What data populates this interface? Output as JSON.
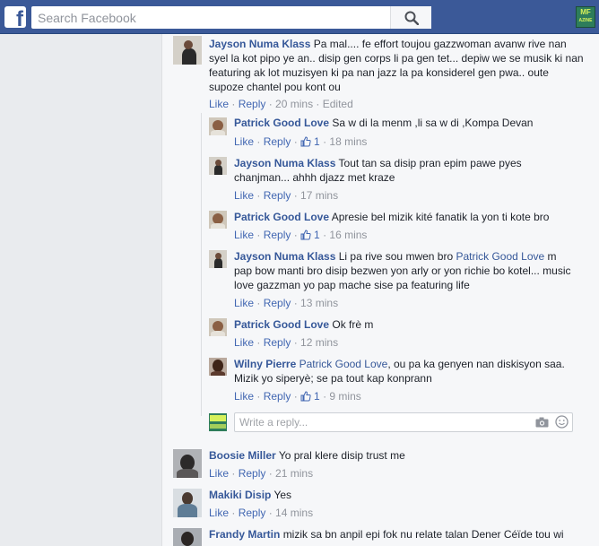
{
  "search": {
    "placeholder": "Search Facebook"
  },
  "header": {
    "logo_letter": "f",
    "brand_badge_line1": "MF",
    "brand_badge_line2": "AZINE"
  },
  "actions": {
    "like": "Like",
    "reply": "Reply",
    "sep": " · "
  },
  "comments": [
    {
      "author": "Jayson Numa Klass",
      "text_lines": [
        "Pa mal.... fe effort toujou gazzwoman avanw rive nan",
        "syel la kot pipo ye an.. disip gen corps li pa gen tet... depiw we se musik ki nan",
        "featuring ak lot muzisyen ki pa nan jazz la pa konsiderel gen pwa.. oute",
        "supoze chantel pou kont ou"
      ],
      "time": "20 mins",
      "edited": "Edited"
    }
  ],
  "replies": [
    {
      "author": "Patrick Good Love",
      "text": "Sa w di la menm ,li sa w di ,Kompa Devan",
      "likes": "1",
      "time": "18 mins"
    },
    {
      "author": "Jayson Numa Klass",
      "text_lines": [
        "Tout tan sa disip pran epim pawe pyes",
        "chanjman... ahhh djazz met kraze"
      ],
      "time": "17 mins"
    },
    {
      "author": "Patrick Good Love",
      "text": "Apresie bel mizik kité fanatik la yon ti kote bro",
      "likes": "1",
      "time": "16 mins"
    },
    {
      "author": "Jayson Numa Klass",
      "text_pre": "Li pa rive sou mwen bro ",
      "mention": "Patrick Good Love",
      "text_post": " m",
      "text_lines": [
        "pap bow manti bro disip bezwen yon arly or yon richie bo kotel... music",
        "love gazzman yo pap mache sise pa featuring life"
      ],
      "time": "13 mins"
    },
    {
      "author": "Patrick Good Love",
      "text": "Ok frè m",
      "time": "12 mins"
    },
    {
      "author": "Wilny Pierre",
      "mention": "Patrick Good Love",
      "text_post": ", ou pa ka genyen nan diskisyon saa.",
      "text_lines": [
        "Mizik yo siperyè; se pa tout kap konprann"
      ],
      "likes": "1",
      "time": "9 mins"
    }
  ],
  "reply_box": {
    "placeholder": "Write a reply..."
  },
  "bottom_comments": [
    {
      "author": "Boosie Miller",
      "text": "Yo pral klere disip trust me",
      "time": "21 mins"
    },
    {
      "author": "Makiki Disip",
      "text": "Yes",
      "time": "14 mins"
    },
    {
      "author": "Frandy Martin",
      "text": "mizik sa bn anpil epi fok nu relate talan Dener Céïde tou wi"
    }
  ],
  "colors": {
    "header": "#3b5998",
    "link": "#4267b2",
    "author": "#365899",
    "meta": "#90949c",
    "panel": "#f6f7f9",
    "page": "#e9ebee"
  },
  "icons": [
    "facebook-logo-icon",
    "search-icon",
    "thumbs-up-icon",
    "camera-icon",
    "smiley-icon"
  ]
}
